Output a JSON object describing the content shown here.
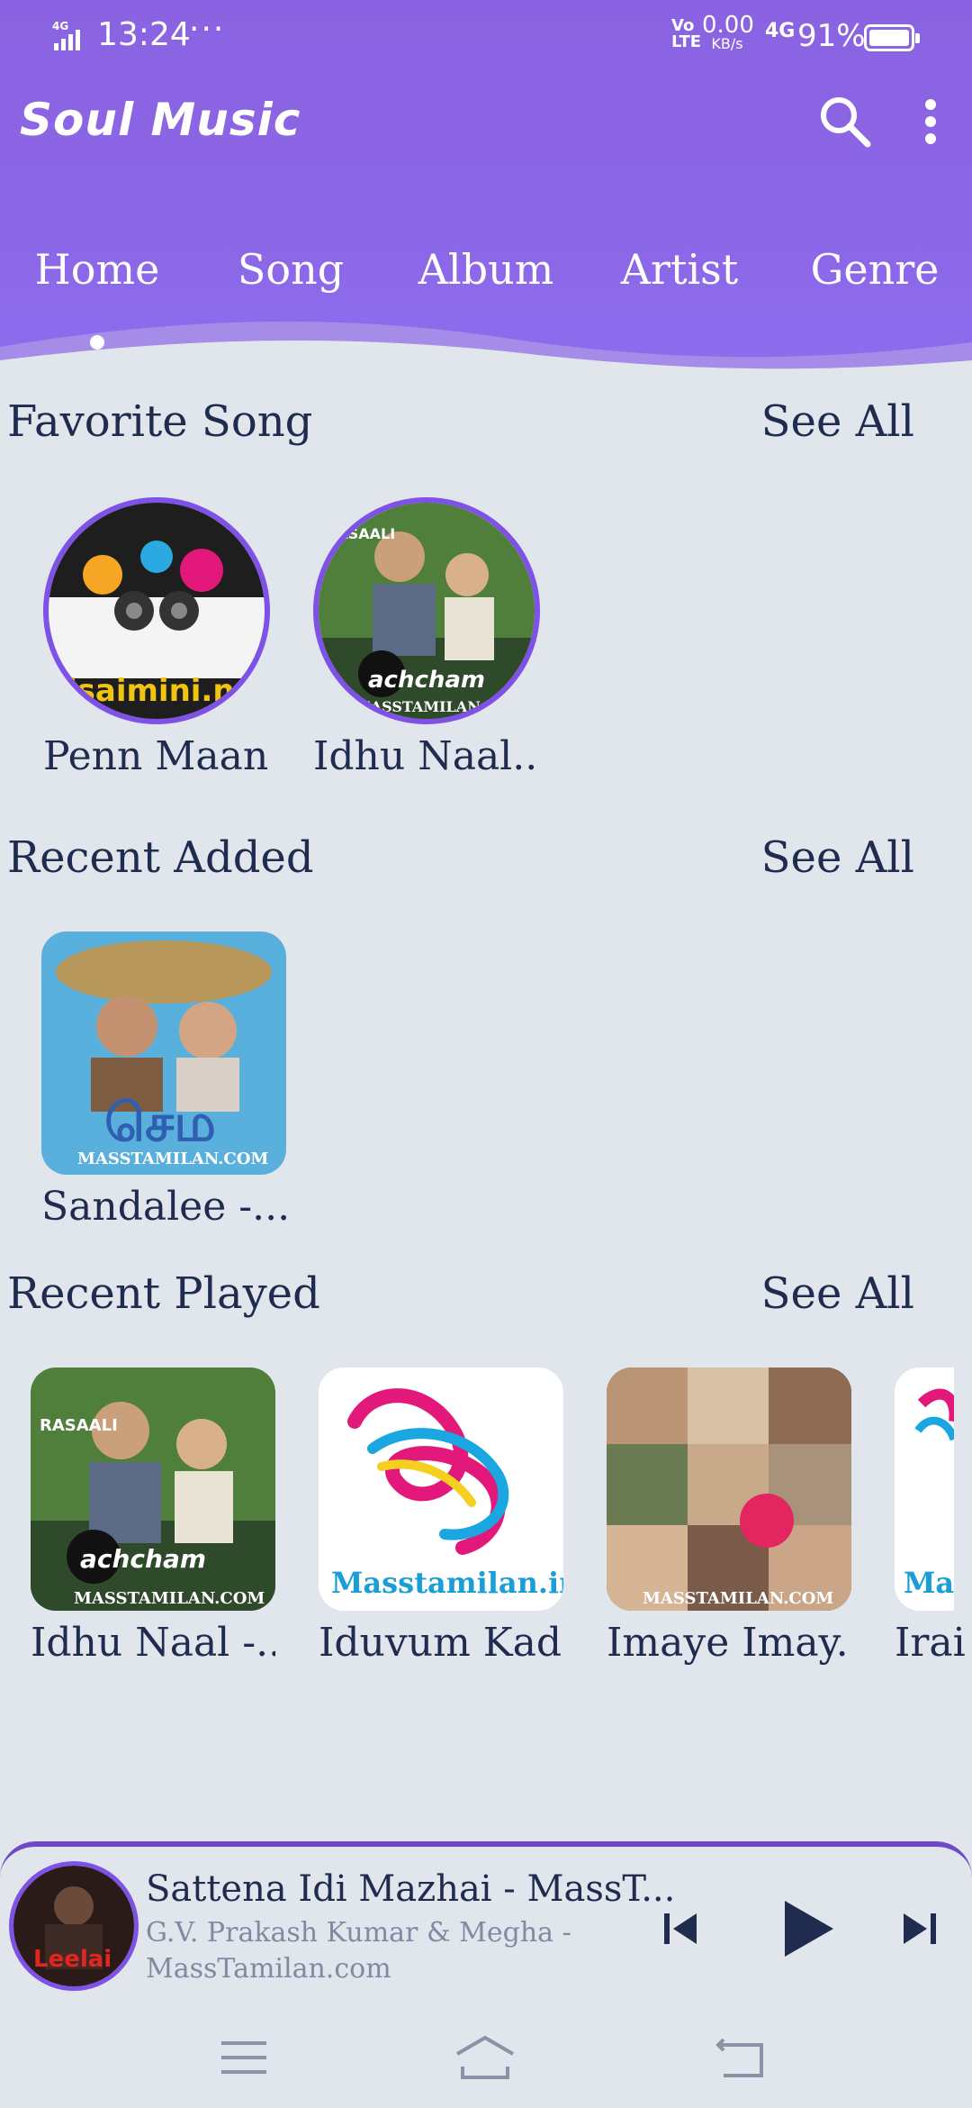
{
  "status_bar": {
    "time": "13:24",
    "dots": "···",
    "network_label": "Vo LTE",
    "speed_value": "0.00",
    "speed_unit": "KB/s",
    "network_type": "4G",
    "battery": "91%",
    "battery_level": 0.91
  },
  "app": {
    "title": "Soul Music",
    "accent_color": "#8b63e2",
    "icons": [
      "search-icon",
      "more-vert-icon"
    ]
  },
  "tabs": [
    {
      "label": "Home",
      "selected": true
    },
    {
      "label": "Song"
    },
    {
      "label": "Album"
    },
    {
      "label": "Artist"
    },
    {
      "label": "Genre"
    }
  ],
  "sections": {
    "favorite": {
      "title": "Favorite Song",
      "see_all": "See All",
      "items": [
        {
          "label": "Penn Maan...",
          "art_text": "isaimini.net"
        },
        {
          "label": "Idhu Naal...",
          "art_text": "MASSTAMILAN.COM"
        }
      ]
    },
    "recent_added": {
      "title": "Recent Added",
      "see_all": "See All",
      "items": [
        {
          "label": "Sandalee -...",
          "art_text": "MASSTAMILAN.COM"
        }
      ]
    },
    "recent_played": {
      "title": "Recent Played",
      "see_all": "See All",
      "items": [
        {
          "label": "Idhu Naal -...",
          "art_text": "MASSTAMILAN.COM"
        },
        {
          "label": "Iduvum Kad...",
          "art_text": "Masstamilan.in"
        },
        {
          "label": "Imaye Imay...",
          "art_text": "MASSTAMILAN.COM"
        },
        {
          "label": "Irai",
          "art_text": "Ma"
        }
      ]
    }
  },
  "now_playing": {
    "title": "Sattena Idi Mazhai - MassT...",
    "artist": "G.V. Prakash Kumar & Megha - MassTamilan.com",
    "controls": [
      "previous-icon",
      "play-icon",
      "next-icon"
    ]
  },
  "system_nav": [
    "menu-icon",
    "home-icon",
    "back-icon"
  ]
}
